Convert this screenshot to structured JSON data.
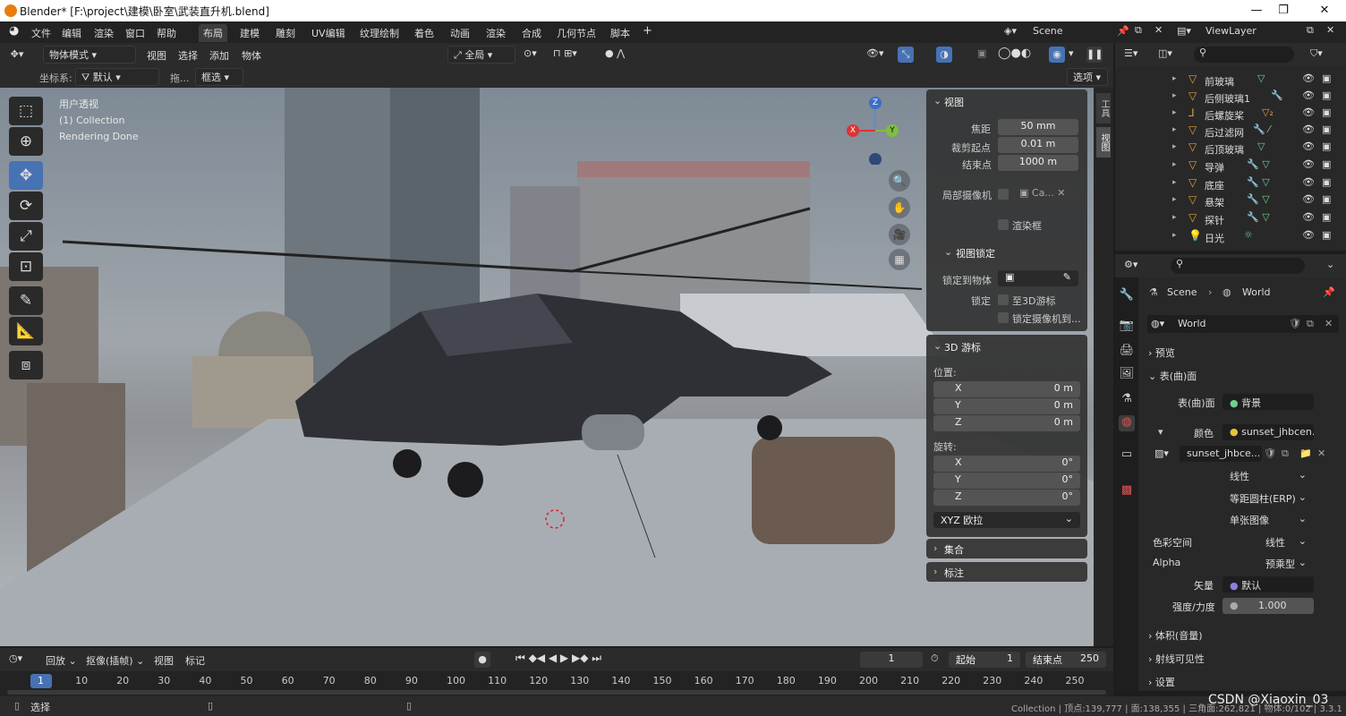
{
  "window": {
    "title": "Blender* [F:\\project\\建模\\卧室\\武装直升机.blend]",
    "buttons": [
      "—",
      "❐",
      "✕"
    ]
  },
  "menu": {
    "items": [
      "文件",
      "编辑",
      "渲染",
      "窗口",
      "帮助"
    ],
    "workspaces": [
      "布局",
      "建模",
      "雕刻",
      "UV编辑",
      "纹理绘制",
      "着色",
      "动画",
      "渲染",
      "合成",
      "几何节点",
      "脚本"
    ],
    "add": "+",
    "scene": "Scene",
    "viewlayer": "ViewLayer"
  },
  "viewport_header": {
    "mode": "物体模式",
    "menus": [
      "视图",
      "选择",
      "添加",
      "物体"
    ],
    "orientation": "全局",
    "options": "选项"
  },
  "tool_header": {
    "coord_label": "坐标系:",
    "coord_value": "默认",
    "drag_label": "拖...",
    "drag_value": "框选"
  },
  "overlay_text": {
    "line1": "用户透视",
    "line2": "(1) Collection",
    "line3": "Rendering Done"
  },
  "gizmo": {
    "z": "Z",
    "y": "Y",
    "x": "X"
  },
  "n_panel": {
    "view_title": "视图",
    "focal_label": "焦距",
    "focal_value": "50 mm",
    "clip_start_label": "裁剪起点",
    "clip_start_value": "0.01 m",
    "clip_end_label": "结束点",
    "clip_end_value": "1000 m",
    "local_cam_label": "局部摄像机",
    "local_cam_value": "Ca...",
    "render_border": "渲染框",
    "lock_title": "视图锁定",
    "lock_obj_label": "锁定到物体",
    "lock_label": "锁定",
    "lock_3d": "至3D游标",
    "lock_cam": "锁定摄像机到...",
    "cursor_title": "3D 游标",
    "location_label": "位置:",
    "loc": [
      {
        "axis": "X",
        "value": "0 m"
      },
      {
        "axis": "Y",
        "value": "0 m"
      },
      {
        "axis": "Z",
        "value": "0 m"
      }
    ],
    "rotation_label": "旋转:",
    "rot": [
      {
        "axis": "X",
        "value": "0°"
      },
      {
        "axis": "Y",
        "value": "0°"
      },
      {
        "axis": "Z",
        "value": "0°"
      }
    ],
    "rot_mode": "XYZ 欧拉",
    "collection": "集合",
    "annotation": "标注",
    "side_tabs": [
      "工具",
      "视图"
    ]
  },
  "outliner": {
    "items": [
      "前玻璃",
      "后侧玻璃1",
      "后螺旋桨",
      "后过滤网",
      "后顶玻璃",
      "导弹",
      "底座",
      "悬架",
      "探针",
      "日光"
    ]
  },
  "properties": {
    "breadcrumb_scene": "Scene",
    "breadcrumb_world": "World",
    "world_name": "World",
    "preview": "预览",
    "surface": "表(曲)面",
    "surface_label": "表(曲)面",
    "surface_value": "背景",
    "color_label": "颜色",
    "color_value": "sunset_jhbcen...",
    "image_name": "sunset_jhbce...",
    "interp": "线性",
    "projection": "等距圆柱(ERP)",
    "source": "单张图像",
    "colorspace_label": "色彩空间",
    "colorspace_value": "线性",
    "alpha_label": "Alpha",
    "alpha_value": "预乘型",
    "vector_label": "矢量",
    "vector_value": "默认",
    "strength_label": "强度/力度",
    "strength_value": "1.000",
    "volume": "体积(音量)",
    "ray_vis": "射线可见性",
    "settings": "设置"
  },
  "timeline": {
    "menus": [
      "回放",
      "抠像(插帧)",
      "视图",
      "标记"
    ],
    "current_frame": "1",
    "start_label": "起始",
    "start_value": "1",
    "end_label": "结束点",
    "end_value": "250",
    "ticks": [
      "1",
      "10",
      "20",
      "30",
      "40",
      "50",
      "60",
      "70",
      "80",
      "90",
      "100",
      "110",
      "120",
      "130",
      "140",
      "150",
      "160",
      "170",
      "180",
      "190",
      "200",
      "210",
      "220",
      "230",
      "240",
      "250"
    ]
  },
  "statusbar": {
    "select": "选择",
    "right": "Collection | 顶点:139,777 | 面:138,355 | 三角面:262,821 | 物体:0/102 | 3.3.1",
    "watermark": "CSDN @Xiaoxin_03"
  },
  "colors": {
    "accent": "#4772b3",
    "orange": "#e87d0d",
    "panel": "#303030"
  }
}
